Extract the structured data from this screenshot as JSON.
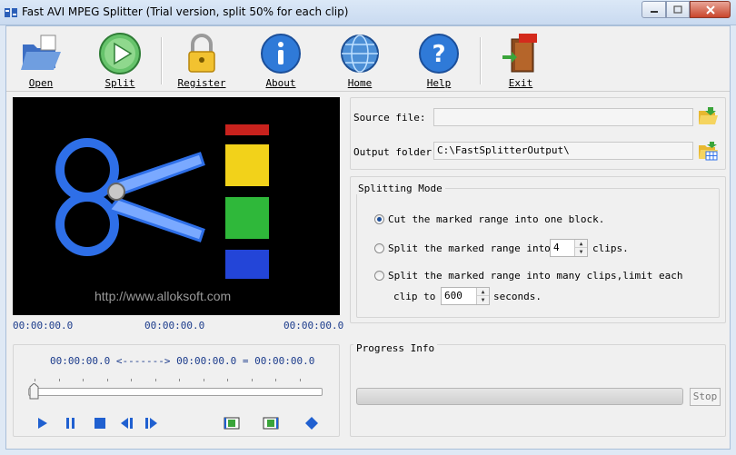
{
  "window": {
    "title": "Fast AVI MPEG Splitter (Trial version, split 50% for each clip)"
  },
  "toolbar": {
    "open": "Open",
    "split": "Split",
    "register": "Register",
    "about": "About",
    "home": "Home",
    "help": "Help",
    "exit": "Exit"
  },
  "preview": {
    "url": "http://www.alloksoft.com",
    "time_start": "00:00:00.0",
    "time_mid": "00:00:00.0",
    "time_end": "00:00:00.0"
  },
  "files": {
    "source_label": "Source file:",
    "source_value": "",
    "output_label": "Output folder:",
    "output_value": "C:\\FastSplitterOutput\\"
  },
  "splitting": {
    "title": "Splitting Mode",
    "opt1": "Cut the marked range into one block.",
    "opt2_a": "Split the marked range into",
    "opt2_value": "4",
    "opt2_b": "clips.",
    "opt3_a": "Split the marked range into many clips,limit each",
    "opt3_b": "clip to",
    "opt3_value": "600",
    "opt3_c": "seconds.",
    "selected": 1
  },
  "range": {
    "text": "00:00:00.0 <-------> 00:00:00.0 =  00:00:00.0"
  },
  "progress": {
    "title": "Progress Info",
    "value": 0,
    "stop": "Stop"
  },
  "colors": {
    "accent": "#1c3c8c",
    "titlebar": "#c9daf0"
  }
}
